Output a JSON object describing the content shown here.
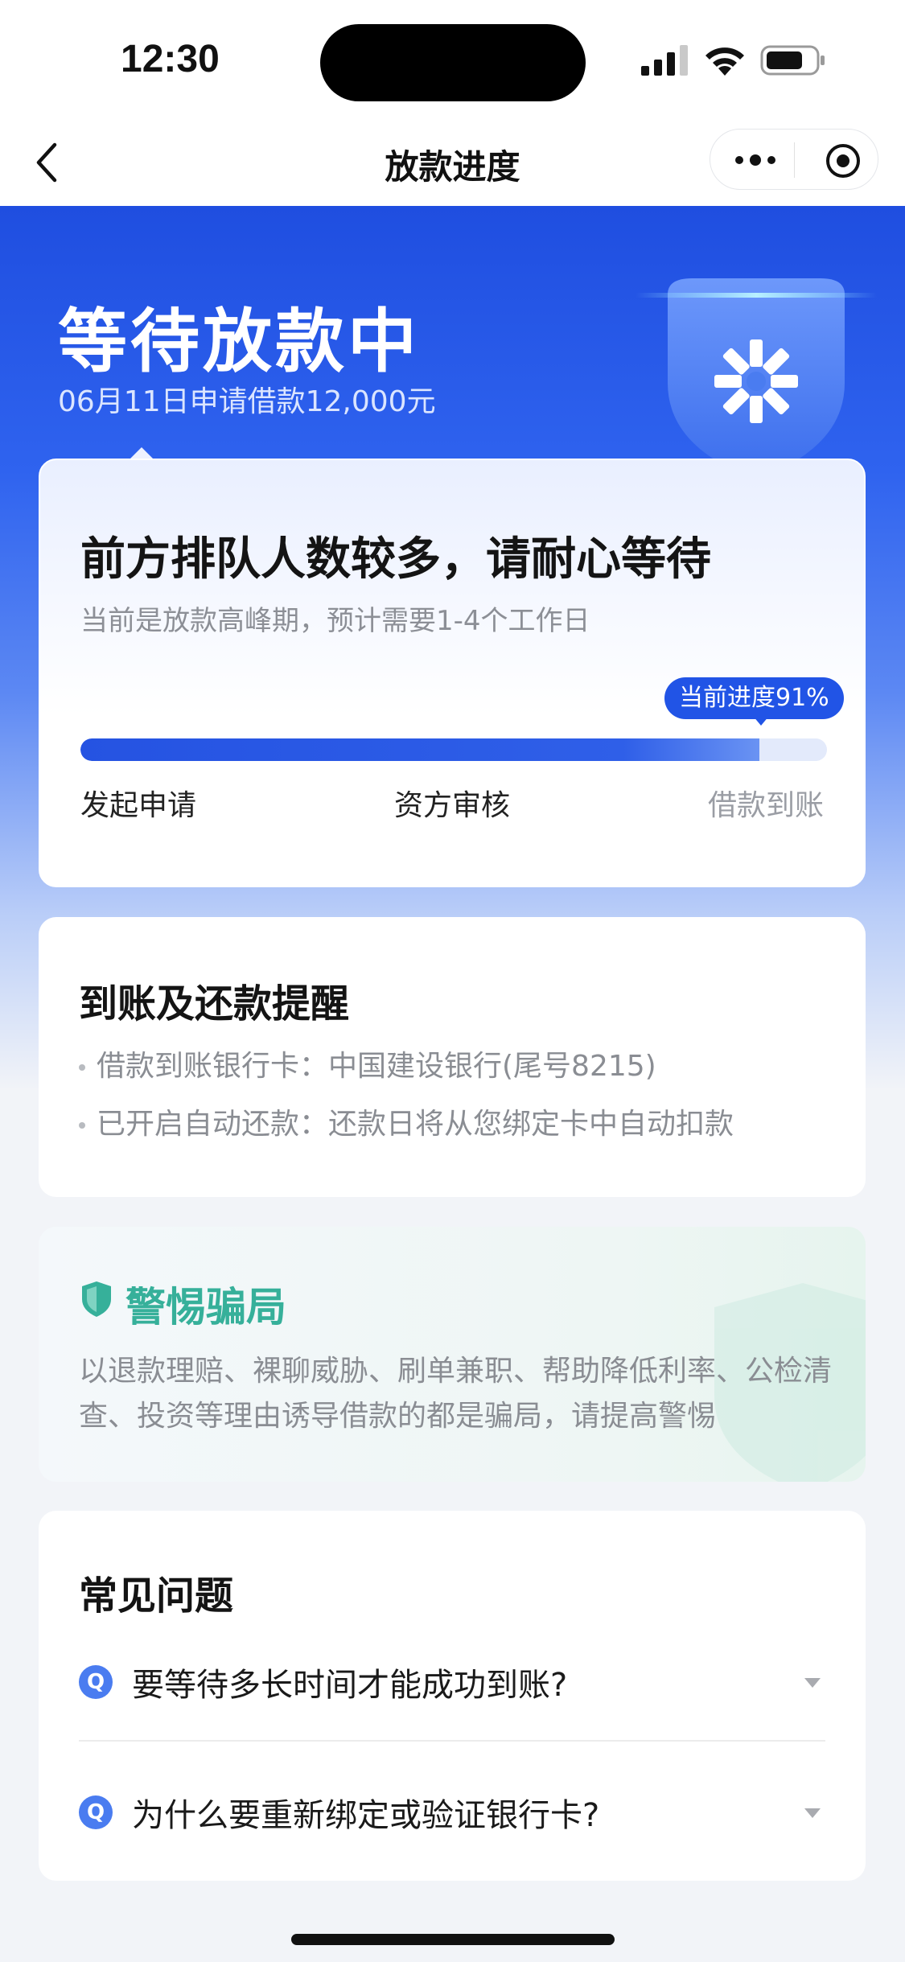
{
  "status_bar": {
    "time": "12:30"
  },
  "nav": {
    "title": "放款进度",
    "back_icon": "chevron-left-icon",
    "more_icon": "more-dots-icon",
    "target_icon": "target-icon"
  },
  "hero": {
    "title": "等待放款中",
    "subtitle": "06月11日申请借款12,000元",
    "badge_icon": "shield-logo-icon"
  },
  "progress_card": {
    "title": "前方排队人数较多，请耐心等待",
    "subtitle": "当前是放款高峰期，预计需要1-4个工作日",
    "progress_label": "当前进度91%",
    "progress_fraction": 0.91,
    "steps": [
      "发起申请",
      "资方审核",
      "借款到账"
    ],
    "colors": {
      "accent": "#2154e6",
      "track": "#e3eafb"
    }
  },
  "reminder_card": {
    "title": "到账及还款提醒",
    "items": [
      "借款到账银行卡：中国建设银行(尾号8215)",
      "已开启自动还款：还款日将从您绑定卡中自动扣款"
    ]
  },
  "fraud_card": {
    "icon": "shield-check-icon",
    "title": "警惕骗局",
    "body": "以退款理赔、裸聊威胁、刷单兼职、帮助降低利率、公检清查、投资等理由诱导借款的都是骗局，请提高警惕",
    "color": "#36b09a"
  },
  "faq_card": {
    "title": "常见问题",
    "badge": "Q",
    "questions": [
      "要等待多长时间才能成功到账?",
      "为什么要重新绑定或验证银行卡?"
    ]
  }
}
